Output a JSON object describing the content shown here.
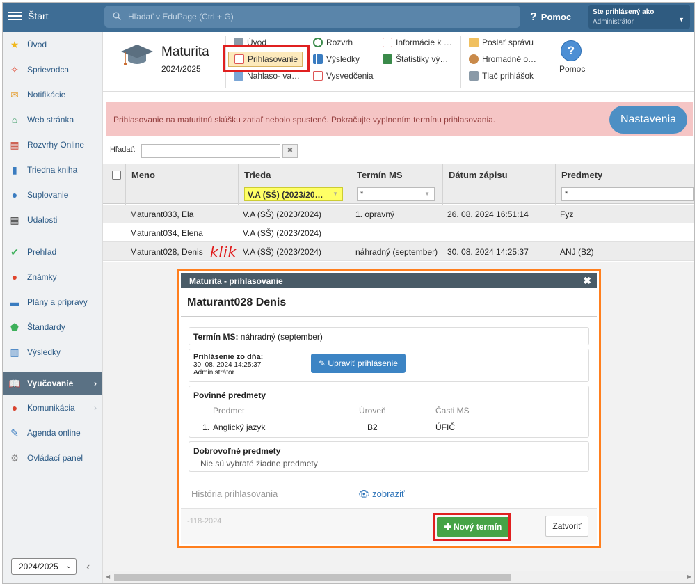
{
  "topbar": {
    "start": "Štart",
    "search_placeholder": "Hľadať v EduPage (Ctrl + G)",
    "help": "Pomoc",
    "user_line1": "Ste prihlásený ako",
    "user_line2": "Administrátor"
  },
  "sidebar": {
    "items": [
      {
        "label": "Úvod",
        "icon": "star-icon"
      },
      {
        "label": "Sprievodca",
        "icon": "wand-icon"
      },
      {
        "label": "Notifikácie",
        "icon": "envelope-icon"
      },
      {
        "label": "Web stránka",
        "icon": "house-icon"
      },
      {
        "label": "Rozvrhy Online",
        "icon": "grid-icon"
      },
      {
        "label": "Triedna kniha",
        "icon": "book-icon"
      },
      {
        "label": "Suplovanie",
        "icon": "person-icon"
      },
      {
        "label": "Udalosti",
        "icon": "calendar-icon"
      },
      {
        "label": "Prehľad",
        "icon": "check-circle-icon"
      },
      {
        "label": "Známky",
        "icon": "grade-icon"
      },
      {
        "label": "Plány a prípravy",
        "icon": "briefcase-icon"
      },
      {
        "label": "Štandardy",
        "icon": "shield-check-icon"
      },
      {
        "label": "Výsledky",
        "icon": "bar-chart-icon"
      },
      {
        "label": "Vyučovanie",
        "icon": "open-book-icon"
      },
      {
        "label": "Komunikácia",
        "icon": "chat-icon"
      },
      {
        "label": "Agenda online",
        "icon": "pen-icon"
      },
      {
        "label": "Ovládací panel",
        "icon": "gear-icon"
      }
    ],
    "year": "2024/2025"
  },
  "header": {
    "title": "Maturita",
    "year": "2024/2025",
    "buttons": {
      "uvod": "Úvod",
      "prihlasovanie": "Prihlasovanie",
      "nahlaso": "Nahlaso- va…",
      "rozvrh": "Rozvrh",
      "vysledky": "Výsledky",
      "vysvedcenia": "Vysvedčenia",
      "informacie": "Informácie k …",
      "statistiky": "Štatistiky vý…",
      "poslat": "Poslať správu",
      "hromadne": "Hromadné o…",
      "tlac": "Tlač prihlášok",
      "pomoc": "Pomoc"
    }
  },
  "alert": {
    "text": "Prihlasovanie na maturitnú skúšku zatiaľ nebolo spustené. Pokračujte vyplnením termínu prihlasovania.",
    "button": "Nastavenia"
  },
  "filter": {
    "label": "Hľadať:",
    "clear": "✖"
  },
  "table": {
    "headers": {
      "meno": "Meno",
      "trieda": "Trieda",
      "termin": "Termín MS",
      "datum": "Dátum zápisu",
      "predmety": "Predmety"
    },
    "filters": {
      "trieda": "V.A (SŠ) (2023/20…",
      "termin": "*",
      "predmety": "*"
    },
    "rows": [
      {
        "meno": "Maturant033, Ela",
        "trieda": "V.A (SŠ) (2023/2024)",
        "termin": "1. opravný",
        "datum": "26. 08. 2024 16:51:14",
        "predmety": "Fyz"
      },
      {
        "meno": "Maturant034, Elena",
        "trieda": "V.A (SŠ) (2023/2024)",
        "termin": "",
        "datum": "",
        "predmety": ""
      },
      {
        "meno": "Maturant028, Denis",
        "trieda": "V.A (SŠ) (2023/2024)",
        "termin": "náhradný (september)",
        "datum": "30. 08. 2024 14:25:37",
        "predmety": "ANJ (B2)"
      }
    ],
    "annotation": "klik"
  },
  "modal": {
    "title": "Maturita - prihlasovanie",
    "name": "Maturant028 Denis",
    "termin_label": "Termín MS:",
    "termin_value": "náhradný (september)",
    "prihlasenie_label": "Prihlásenie zo dňa:",
    "prihlasenie_date": "30. 08. 2024 14:25:37",
    "prihlasenie_user": "Administrátor",
    "upravit": "Upraviť prihlásenie",
    "povinne": "Povinné predmety",
    "col_predmet": "Predmet",
    "col_uroven": "Úroveň",
    "col_casti": "Časti MS",
    "subj_num": "1.",
    "subj_name": "Anglický jazyk",
    "subj_level": "B2",
    "subj_parts": "ÚFIČ",
    "dobrovolne": "Dobrovoľné predmety",
    "none_selected": "Nie sú vybraté žiadne predmety",
    "historia": "História prihlasovania",
    "zobrazit": "zobraziť",
    "code": "-118-2024",
    "novy": "Nový termín",
    "zavriet": "Zatvoriť"
  }
}
